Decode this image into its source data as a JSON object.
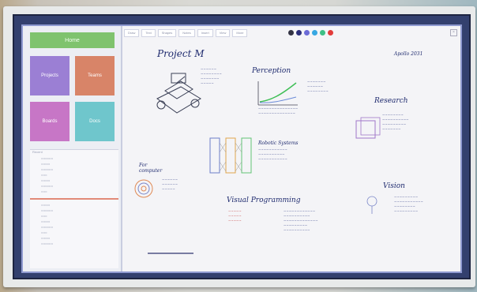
{
  "sidebar": {
    "top_button": "Home",
    "tiles": [
      "Projects",
      "Teams",
      "Boards",
      "Docs"
    ],
    "list_header": "Recent"
  },
  "toolbar": {
    "tabs": [
      "Draw",
      "Text",
      "Shapes",
      "Notes",
      "Insert",
      "View",
      "More"
    ],
    "swatch_colors": [
      "#333344",
      "#2c2f7a",
      "#6b6bd6",
      "#36a7e2",
      "#3fbf86",
      "#e23b3b"
    ]
  },
  "canvas": {
    "title": "Project M",
    "corner_note": "Apollo 2031",
    "section_perception": "Perception",
    "section_research": "Research",
    "section_vision": "Vision",
    "section_robotic": "Robotic Systems",
    "section_visual_programming": "Visual Programming",
    "section_for": "For computer"
  },
  "colors": {
    "accent_green": "#7fc36e",
    "tile_purple": "#9b7fd4",
    "tile_orange": "#d88468",
    "tile_pink": "#c776c6",
    "tile_cyan": "#6fc6cc",
    "ink": "#1e2a6e"
  }
}
